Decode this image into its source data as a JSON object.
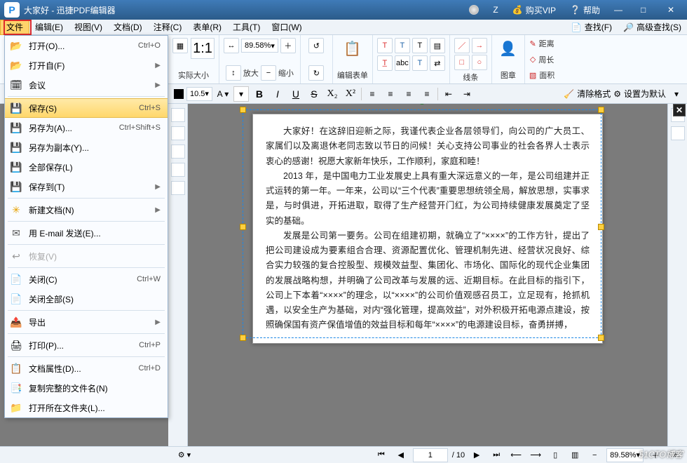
{
  "title": "大家好 - 迅捷PDF编辑器",
  "titlebar": {
    "user": "Z",
    "buy_vip": "购买VIP",
    "help": "帮助"
  },
  "menu": {
    "file": "文件",
    "edit": "编辑(E)",
    "view": "视图(V)",
    "document": "文档(D)",
    "comment": "注释(C)",
    "form": "表单(R)",
    "tool": "工具(T)",
    "window": "窗口(W)",
    "search": "查找(F)",
    "adv_search": "高级查找(S)"
  },
  "file_menu": {
    "open": "打开(O)...",
    "open_sc": "Ctrl+O",
    "open_from": "打开自(F)",
    "session": "会议",
    "save": "保存(S)",
    "save_sc": "Ctrl+S",
    "save_as": "另存为(A)...",
    "save_as_sc": "Ctrl+Shift+S",
    "save_copy": "另存为副本(Y)...",
    "save_all": "全部保存(L)",
    "save_to": "保存到(T)",
    "new_doc": "新建文档(N)",
    "email": "用 E-mail 发送(E)...",
    "restore": "恢复(V)",
    "close": "关闭(C)",
    "close_sc": "Ctrl+W",
    "close_all": "关闭全部(S)",
    "export": "导出",
    "print": "打印(P)...",
    "print_sc": "Ctrl+P",
    "properties": "文档属性(D)...",
    "properties_sc": "Ctrl+D",
    "copy_full": "复制完整的文件名(N)",
    "open_folder": "打开所在文件夹(L)..."
  },
  "ribbon": {
    "actual_size": "实际大小",
    "zoom_value": "89.58%",
    "zoom_in": "放大",
    "zoom_out": "缩小",
    "edit_form": "编辑表单",
    "lines": "线条",
    "graphics": "图章",
    "distance": "距离",
    "perimeter": "周长",
    "area": "面积"
  },
  "format": {
    "font_size": "10.5",
    "clear_format": "清除格式",
    "set_default": "设置为默认"
  },
  "doc": {
    "p1": "大家好！在这辞旧迎新之际，我谨代表企业各层领导们，向公司的广大员工、家属们以及离退休老同志致以节日的问候！关心支持公司事业的社会各界人士表示衷心的感谢！祝愿大家新年快乐，工作顺利，家庭和睦！",
    "p2": "2013 年，是中国电力工业发展史上具有重大深远意义的一年，是公司组建并正式运转的第一年。一年来，公司以“三个代表”重要思想统领全局，解放思想，实事求是，与时俱进，开拓进取，取得了生产经营开门红，为公司持续健康发展奠定了坚实的基础。",
    "p3": "发展是公司第一要务。公司在组建初期，就确立了“××××”的工作方针，提出了把公司建设成为要素组合合理、资源配置优化、管理机制先进、经营状况良好、综合实力较强的复合控股型、规模效益型、集团化、市场化、国际化的现代企业集团的发展战略构想，并明确了公司改革与发展的远、近期目标。在此目标的指引下，公司上下本着“××××”的理念，以“××××”的公司价值观感召员工，立足现有，抢抓机遇，以安全生产为基础，对内“强化管理，提高效益”，对外积极开拓电源点建设，按照确保国有资产保值增值的效益目标和每年“××××”的电源建设目标，奋勇拼搏，"
  },
  "status": {
    "page": "1",
    "total": "10",
    "zoom": "89.58%"
  },
  "watermark": "51CTO博客"
}
